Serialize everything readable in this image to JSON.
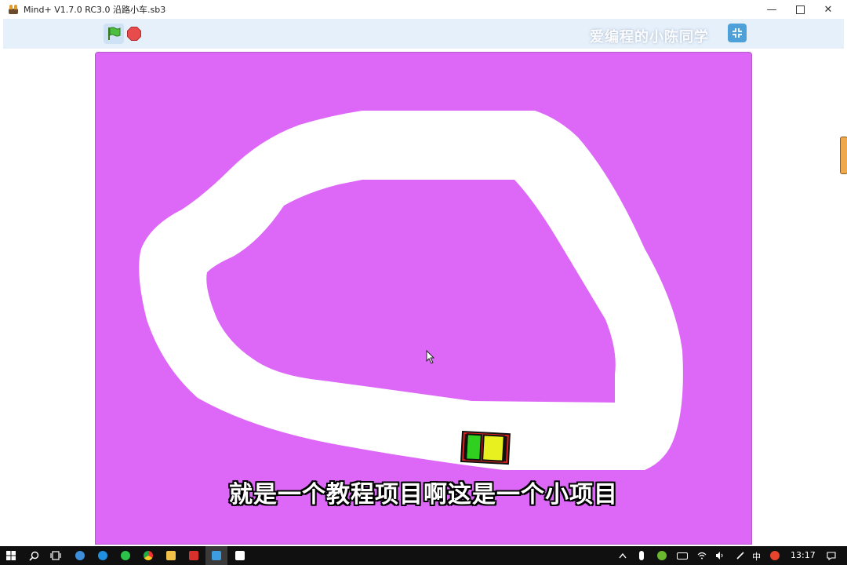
{
  "window": {
    "title": "Mind+ V1.7.0 RC3.0   沿路小车.sb3",
    "controls": {
      "minimize": "—",
      "maximize": "",
      "close": "✕"
    }
  },
  "toolbar": {
    "green_flag_icon": "green-flag-icon",
    "stop_icon": "stop-icon",
    "fullscreen_icon": "exit-fullscreen-icon",
    "watermark": "爱编程的小陈同学"
  },
  "stage": {
    "background_color": "#dd68f8",
    "track_color": "#ffffff",
    "subtitle": "就是一个教程项目啊这是一个小项目",
    "sprite": "car-sprite"
  },
  "taskbar": {
    "apps": [
      "windows-start-icon",
      "search-icon",
      "task-view-icon",
      "browser-icon",
      "edge-icon",
      "wechat-icon",
      "chrome-icon",
      "file-explorer-icon",
      "wps-icon",
      "mindplus-icon",
      "capcut-icon"
    ],
    "tray": {
      "ime": "中",
      "time": "13:17"
    }
  }
}
